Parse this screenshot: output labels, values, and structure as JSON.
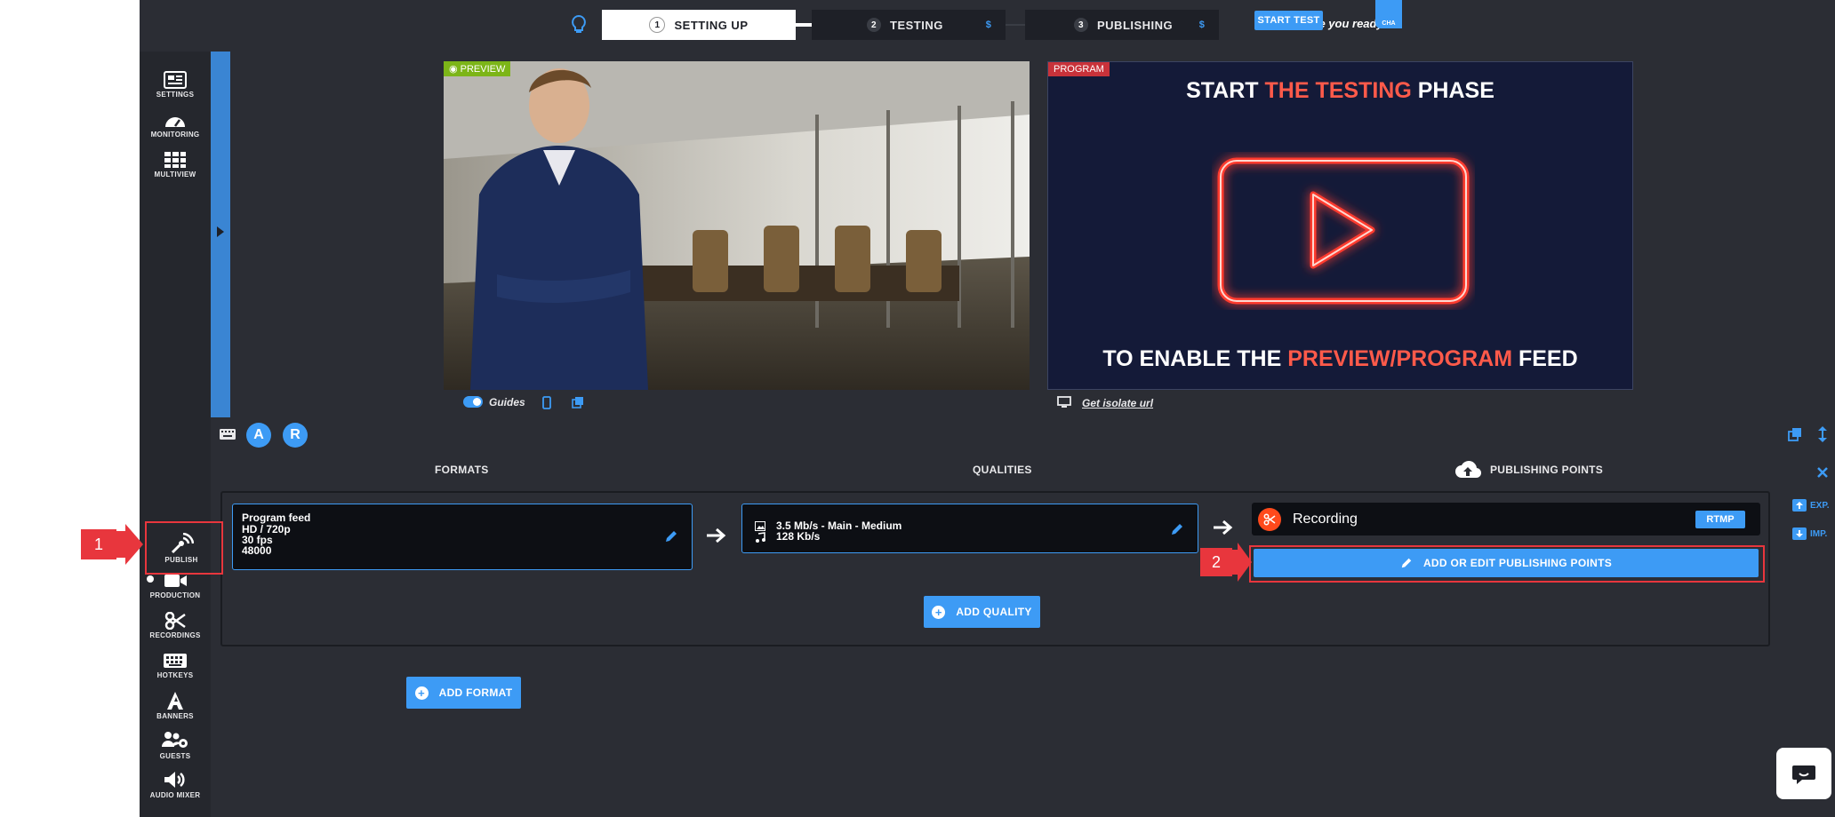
{
  "topbar": {
    "steps": [
      {
        "num": "1",
        "label": "SETTING UP"
      },
      {
        "num": "2",
        "label": "TESTING",
        "badge": "$"
      },
      {
        "num": "3",
        "label": "PUBLISHING",
        "badge": "$"
      }
    ],
    "ready_text": "Are you ready ?",
    "start_test_label": "START TEST",
    "chat_label": "CHA"
  },
  "sidebar": {
    "top_items": [
      {
        "label": "SETTINGS",
        "icon": "settings-icon"
      },
      {
        "label": "MONITORING",
        "icon": "gauge-icon"
      },
      {
        "label": "MULTIVIEW",
        "icon": "grid-icon"
      }
    ],
    "bottom_items": [
      {
        "label": "PUBLISH",
        "icon": "broadcast-icon"
      },
      {
        "label": "PRODUCTION",
        "icon": "camera-icon"
      },
      {
        "label": "RECORDINGS",
        "icon": "scissors-icon"
      },
      {
        "label": "HOTKEYS",
        "icon": "keyboard-icon"
      },
      {
        "label": "BANNERS",
        "icon": "letter-a-icon"
      },
      {
        "label": "GUESTS",
        "icon": "users-gear-icon"
      },
      {
        "label": "AUDIO MIXER",
        "icon": "speaker-icon"
      }
    ]
  },
  "preview": {
    "label": "PREVIEW",
    "guides_label": "Guides"
  },
  "program": {
    "label": "PROGRAM",
    "line1_pre": "START ",
    "line1_hl": "THE TESTING",
    "line1_post": " PHASE",
    "line2_pre": "TO ENABLE THE ",
    "line2_hl": "PREVIEW/PROGRAM",
    "line2_post": " FEED",
    "isolate_link": "Get isolate url"
  },
  "controls": {
    "badge_a": "A",
    "badge_r": "R"
  },
  "publish": {
    "formats_header": "FORMATS",
    "qualities_header": "QUALITIES",
    "points_header": "PUBLISHING POINTS",
    "format": {
      "name": "Program feed",
      "resolution": "HD / 720p",
      "fps": "30 fps",
      "rate": "48000"
    },
    "quality": {
      "video": "3.5 Mb/s - Main - Medium",
      "audio": "128 Kb/s"
    },
    "point": {
      "name": "Recording",
      "protocol": "RTMP"
    },
    "add_edit_points_label": "ADD OR EDIT PUBLISHING POINTS",
    "add_quality_label": "ADD QUALITY",
    "add_format_label": "ADD FORMAT"
  },
  "right_rail": {
    "export_label": "EXP.",
    "import_label": "IMP."
  },
  "annotations": {
    "step1": "1",
    "step2": "2"
  },
  "colors": {
    "accent": "#3d9bf5",
    "neon_red": "#ff3b2f",
    "preview_green": "#7cb518",
    "program_red": "#c8323a",
    "annotation_red": "#e8363d"
  }
}
